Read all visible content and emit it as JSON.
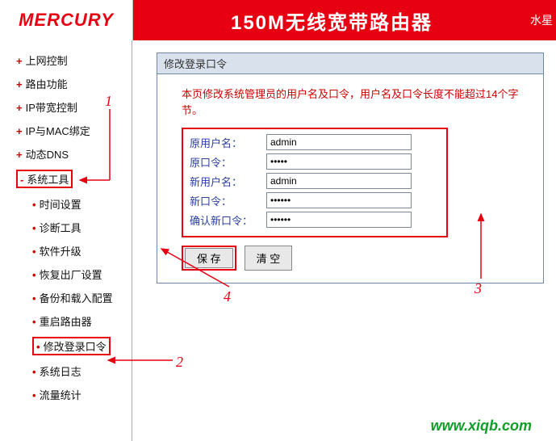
{
  "header": {
    "logo": "MERCURY",
    "title": "150M无线宽带路由器",
    "right": "水星"
  },
  "sidebar": {
    "items": [
      {
        "type": "plus",
        "label": "上网控制"
      },
      {
        "type": "plus",
        "label": "路由功能"
      },
      {
        "type": "plus",
        "label": "IP带宽控制"
      },
      {
        "type": "plus",
        "label": "IP与MAC绑定"
      },
      {
        "type": "plus",
        "label": "动态DNS"
      },
      {
        "type": "minus",
        "label": "系统工具",
        "highlight": true
      },
      {
        "type": "dot",
        "label": "时间设置"
      },
      {
        "type": "dot",
        "label": "诊断工具"
      },
      {
        "type": "dot",
        "label": "软件升级"
      },
      {
        "type": "dot",
        "label": "恢复出厂设置"
      },
      {
        "type": "dot",
        "label": "备份和载入配置"
      },
      {
        "type": "dot",
        "label": "重启路由器"
      },
      {
        "type": "dot",
        "label": "修改登录口令",
        "highlight": true
      },
      {
        "type": "dot",
        "label": "系统日志"
      },
      {
        "type": "dot",
        "label": "流量统计"
      }
    ]
  },
  "panel": {
    "title": "修改登录口令",
    "desc": "本页修改系统管理员的用户名及口令，用户名及口令长度不能超过14个字节。",
    "form": {
      "old_user_label": "原用户名：",
      "old_user_value": "admin",
      "old_pass_label": "原口令：",
      "old_pass_value": "•••••",
      "new_user_label": "新用户名：",
      "new_user_value": "admin",
      "new_pass_label": "新口令：",
      "new_pass_value": "••••••",
      "confirm_label": "确认新口令：",
      "confirm_value": "••••••"
    },
    "buttons": {
      "save": "保 存",
      "clear": "清 空"
    }
  },
  "annotations": {
    "n1": "1",
    "n2": "2",
    "n3": "3",
    "n4": "4"
  },
  "watermark": "www.xiqb.com"
}
